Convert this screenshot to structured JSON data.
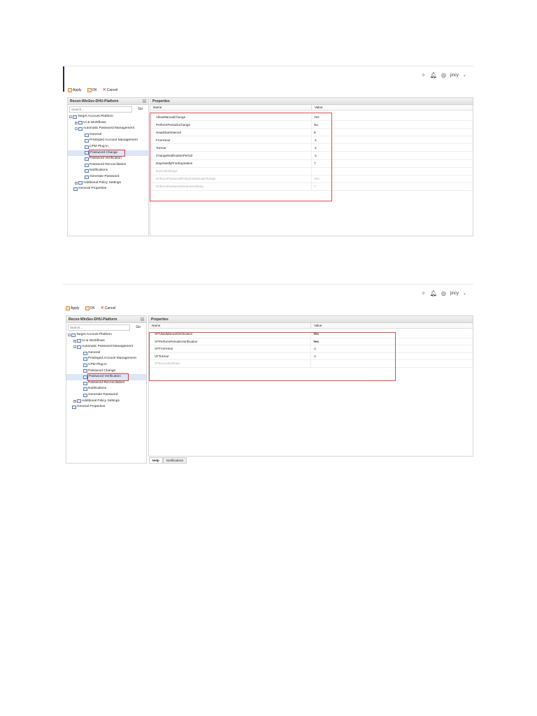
{
  "header": {
    "user": "jincy"
  },
  "toolbar": {
    "apply": "Apply",
    "ok": "OK",
    "cancel": "Cancel"
  },
  "screenshots": [
    {
      "left_title": "Recon-WinSev-DHU-Platform",
      "search_placeholder": "Search...",
      "go": "Go",
      "right_title": "Properties",
      "col_name": "Name",
      "col_value": "Value",
      "tree": [
        {
          "label": "Target Account Platform",
          "level": 0,
          "exp": "-"
        },
        {
          "label": "UI & Workflows",
          "level": 1,
          "exp": "+"
        },
        {
          "label": "Automatic Password Management",
          "level": 1,
          "exp": "-"
        },
        {
          "label": "General",
          "level": 2
        },
        {
          "label": "Privileged Account Management",
          "level": 2
        },
        {
          "label": "CPM Plug-in",
          "level": 2
        },
        {
          "label": "Password Change",
          "level": 2,
          "selected": true
        },
        {
          "label": "Password Verification",
          "level": 2
        },
        {
          "label": "Password Reconciliation",
          "level": 2
        },
        {
          "label": "Notifications",
          "level": 2
        },
        {
          "label": "Generate Password",
          "level": 2
        },
        {
          "label": "Additional Policy Settings",
          "level": 1,
          "exp": "+"
        },
        {
          "label": "General Properties",
          "level": 0
        }
      ],
      "rows": [
        {
          "name": "AllowManualChange",
          "value": "Yes"
        },
        {
          "name": "PerformPeriodicChange",
          "value": "No"
        },
        {
          "name": "HeadStartInterval",
          "value": "5"
        },
        {
          "name": "FromHour",
          "value": "-1"
        },
        {
          "name": "ToHour",
          "value": "-1"
        },
        {
          "name": "ChangeNotificationPeriod",
          "value": "-1"
        },
        {
          "name": "DaysNotifyPriorExpiration",
          "value": "7"
        },
        {
          "name": "ExecutionDays",
          "value": "",
          "disabled": true
        },
        {
          "name": "EnforcePasswordPolicyOnManualChange",
          "value": "Yes",
          "disabled": true
        },
        {
          "name": "EnforcePasswordVersionsHistory",
          "value": "7",
          "disabled": true
        }
      ]
    },
    {
      "left_title": "Recon-WinSev-DHU-Platform",
      "search_placeholder": "Search...",
      "go": "Go",
      "right_title": "Properties",
      "col_name": "Name",
      "col_value": "Value",
      "tree": [
        {
          "label": "Target Account Platform",
          "level": 0,
          "exp": "-"
        },
        {
          "label": "UI & Workflows",
          "level": 1,
          "exp": "+"
        },
        {
          "label": "Automatic Password Management",
          "level": 1,
          "exp": "-"
        },
        {
          "label": "General",
          "level": 2
        },
        {
          "label": "Privileged Account Management",
          "level": 2
        },
        {
          "label": "CPM Plug-in",
          "level": 2
        },
        {
          "label": "Password Change",
          "level": 2
        },
        {
          "label": "Password Verification",
          "level": 2,
          "selected": true
        },
        {
          "label": "Password Reconciliation",
          "level": 2
        },
        {
          "label": "Notifications",
          "level": 2
        },
        {
          "label": "Generate Password",
          "level": 2
        },
        {
          "label": "Additional Policy Settings",
          "level": 1,
          "exp": "+"
        },
        {
          "label": "General Properties",
          "level": 0
        }
      ],
      "rows": [
        {
          "name": "VFAllowManualVerification",
          "value": "Yes",
          "bold": true
        },
        {
          "name": "VFPerformPeriodicVerification",
          "value": "Yes",
          "bold": true
        },
        {
          "name": "VFFromHour",
          "value": "-1"
        },
        {
          "name": "VFToHour",
          "value": "-1"
        },
        {
          "name": "VFExecutionDays",
          "value": "",
          "disabled": true
        }
      ],
      "bottom_tabs": [
        "Help",
        "Notifications"
      ]
    }
  ],
  "colors": {
    "highlight": "#e8464a",
    "selection": "#dce6f7"
  }
}
